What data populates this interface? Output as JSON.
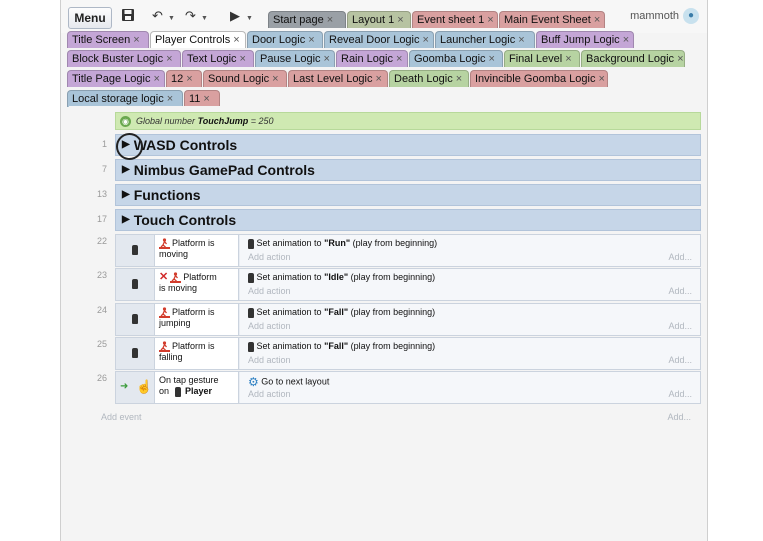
{
  "toolbar": {
    "menu_label": "Menu",
    "save_icon": "save-icon",
    "undo_icon": "undo-icon",
    "redo_icon": "redo-icon",
    "play_icon": "play-icon",
    "brand_name": "mammoth"
  },
  "tabs_row1": [
    {
      "label": "Start page",
      "color": "#9aa0a6"
    },
    {
      "label": "Layout 1",
      "color": "#b7c3a2"
    },
    {
      "label": "Event sheet 1",
      "color": "#d9a0a0"
    },
    {
      "label": "Main Event Sheet",
      "color": "#d9a0a0"
    }
  ],
  "tabs_row2": [
    {
      "label": "Title Screen",
      "color": "#c4a6d6"
    },
    {
      "label": "Player Controls",
      "color": "#ffffff",
      "active": true
    },
    {
      "label": "Door Logic",
      "color": "#a9c4d8"
    },
    {
      "label": "Reveal Door Logic",
      "color": "#a9c4d8"
    },
    {
      "label": "Launcher Logic",
      "color": "#a9c4d8"
    },
    {
      "label": "Buff Jump Logic",
      "color": "#c4a6d6"
    }
  ],
  "tabs_row3": [
    {
      "label": "Block Buster Logic",
      "color": "#c4a6d6"
    },
    {
      "label": "Text Logic",
      "color": "#c4a6d6"
    },
    {
      "label": "Pause Logic",
      "color": "#a9c4d8"
    },
    {
      "label": "Rain Logic",
      "color": "#c4a6d6"
    },
    {
      "label": "Goomba Logic",
      "color": "#a9c4d8"
    },
    {
      "label": "Final Level",
      "color": "#b7d3a2"
    },
    {
      "label": "Background Logic",
      "color": "#b7d3a2"
    }
  ],
  "tabs_row4": [
    {
      "label": "Title Page Logic",
      "color": "#c4a6d6"
    },
    {
      "label": "12",
      "color": "#d9a0a0"
    },
    {
      "label": "Sound Logic",
      "color": "#d9a0a0"
    },
    {
      "label": "Last Level Logic",
      "color": "#d9a0a0"
    },
    {
      "label": "Death Logic",
      "color": "#b7d3a2"
    },
    {
      "label": "Invincible Goomba Logic",
      "color": "#d9a0a0"
    }
  ],
  "tabs_row5": [
    {
      "label": "Local storage logic",
      "color": "#a9c4d8"
    },
    {
      "label": "11",
      "color": "#d9a0a0"
    }
  ],
  "close_glyph": "×",
  "global": {
    "prefix": "Global number",
    "name": "TouchJump",
    "value": "= 250"
  },
  "groups": [
    {
      "num": "1",
      "title": "WASD Controls"
    },
    {
      "num": "7",
      "title": "Nimbus GamePad Controls"
    },
    {
      "num": "13",
      "title": "Functions"
    },
    {
      "num": "17",
      "title": "Touch Controls"
    }
  ],
  "events": [
    {
      "num": "22",
      "cond_line1": "Platform is",
      "cond_line2": "moving",
      "negated": false,
      "action_prefix": "Set animation to",
      "action_value": "\"Run\"",
      "action_suffix": "(play from beginning)"
    },
    {
      "num": "23",
      "cond_line1": "Platform",
      "cond_line2": "is moving",
      "negated": true,
      "action_prefix": "Set animation to",
      "action_value": "\"Idle\"",
      "action_suffix": "(play from beginning)"
    },
    {
      "num": "24",
      "cond_line1": "Platform is",
      "cond_line2": "jumping",
      "negated": false,
      "action_prefix": "Set animation to",
      "action_value": "\"Fall\"",
      "action_suffix": "(play from beginning)"
    },
    {
      "num": "25",
      "cond_line1": "Platform is",
      "cond_line2": "falling",
      "negated": false,
      "action_prefix": "Set animation to",
      "action_value": "\"Fall\"",
      "action_suffix": "(play from beginning)"
    },
    {
      "num": "26",
      "cond_line1": "On tap gesture",
      "cond_line2": "on",
      "cond_obj": "Player",
      "negated": false,
      "action_prefix": "Go to next layout",
      "action_value": "",
      "action_suffix": ""
    }
  ],
  "add_action_label": "Add action",
  "add_right_label": "Add...",
  "add_event_label": "Add event"
}
